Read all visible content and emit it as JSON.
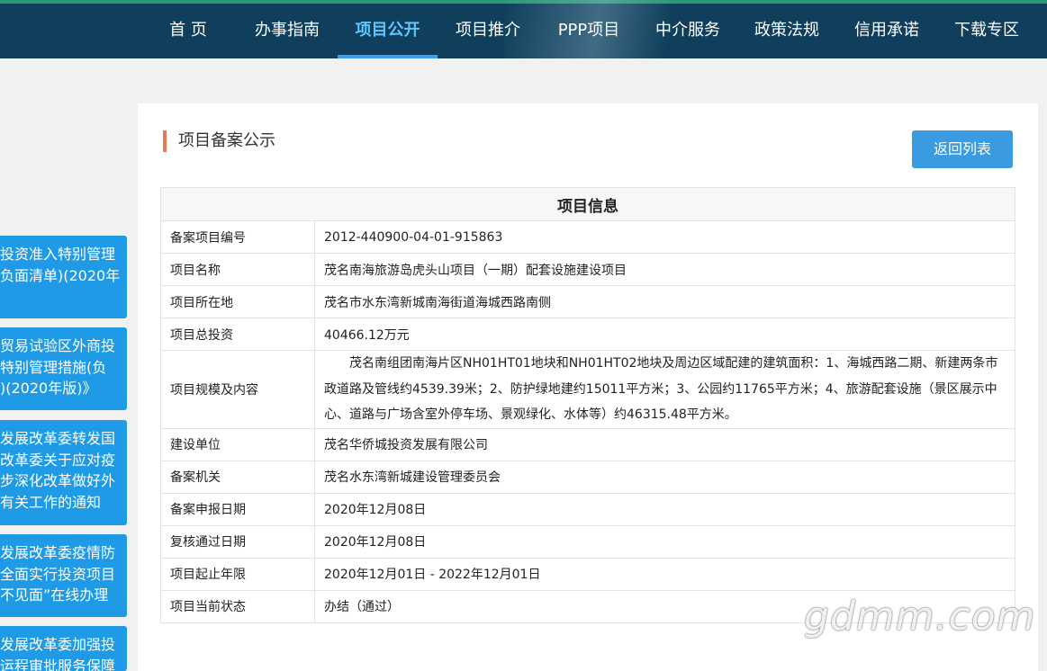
{
  "nav": {
    "items": [
      {
        "label": "首 页"
      },
      {
        "label": "办事指南"
      },
      {
        "label": "项目公开"
      },
      {
        "label": "项目推介"
      },
      {
        "label": "PPP项目"
      },
      {
        "label": "中介服务"
      },
      {
        "label": "政策法规"
      },
      {
        "label": "信用承诺"
      },
      {
        "label": "下载专区"
      }
    ],
    "active": "项目公开"
  },
  "sidebar": {
    "items": [
      {
        "text": "投资准入特别管理\n负面清单)(2020年"
      },
      {
        "text": "贸易试验区外商投\n特别管理措施(负\n)(2020年版)》"
      },
      {
        "text": "发展改革委转发国\n改革委关于应对疫\n步深化改革做好外\n有关工作的通知"
      },
      {
        "text": "发展改革委疫情防\n全面实行投资项目\n不见面”在线办理"
      },
      {
        "text": "发展改革委加强投\n运程审批服务保障"
      }
    ]
  },
  "main": {
    "title": "项目备案公示",
    "back_label": "返回列表",
    "table_title": "项目信息",
    "rows": [
      {
        "key": "备案项目编号",
        "value": "2012-440900-04-01-915863"
      },
      {
        "key": "项目名称",
        "value": "茂名南海旅游岛虎头山项目（一期）配套设施建设项目"
      },
      {
        "key": "项目所在地",
        "value": "茂名市水东湾新城南海街道海城西路南侧"
      },
      {
        "key": "项目总投资",
        "value": "40466.12万元"
      },
      {
        "key": "项目规模及内容",
        "value": "茂名南组团南海片区NH01HT01地块和NH01HT02地块及周边区域配建的建筑面积：1、海城西路二期、新建两条市政道路及管线约4539.39米；2、防护绿地建约15011平方米；3、公园约11765平方米；4、旅游配套设施（景区展示中心、道路与广场含室外停车场、景观绿化、水体等）约46315.48平方米。"
      },
      {
        "key": "建设单位",
        "value": "茂名华侨城投资发展有限公司"
      },
      {
        "key": "备案机关",
        "value": "茂名水东湾新城建设管理委员会"
      },
      {
        "key": "备案申报日期",
        "value": "2020年12月08日"
      },
      {
        "key": "复核通过日期",
        "value": "2020年12月08日"
      },
      {
        "key": "项目起止年限",
        "value": "2020年12月01日 - 2022年12月01日"
      },
      {
        "key": "项目当前状态",
        "value": "办结（通过）"
      }
    ]
  },
  "watermark": "gdmm.com",
  "colors": {
    "header_bg": "#0f3f5c",
    "accent_blue": "#3a9be0",
    "sidebar_blue": "#1e9ae6",
    "title_bar": "#e8775a"
  }
}
